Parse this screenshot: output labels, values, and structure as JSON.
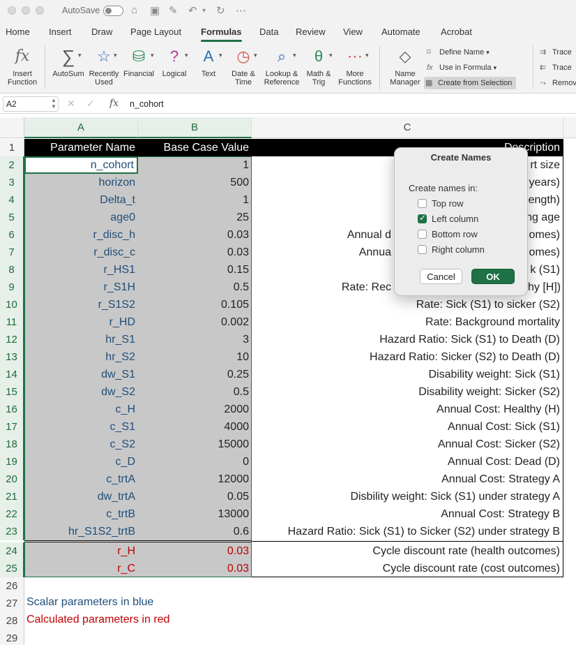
{
  "titlebar": {
    "autosave_label": "AutoSave",
    "autosave_state": "off"
  },
  "tabs": [
    "Home",
    "Insert",
    "Draw",
    "Page Layout",
    "Formulas",
    "Data",
    "Review",
    "View",
    "Automate",
    "Acrobat"
  ],
  "active_tab": "Formulas",
  "ribbon": {
    "insert_function": [
      "Insert",
      "Function"
    ],
    "autosum": "AutoSum",
    "recently_used": [
      "Recently",
      "Used"
    ],
    "financial": "Financial",
    "logical": "Logical",
    "text": "Text",
    "date_time": [
      "Date &",
      "Time"
    ],
    "lookup_reference": [
      "Lookup &",
      "Reference"
    ],
    "math_trig": [
      "Math &",
      "Trig"
    ],
    "more_functions": [
      "More",
      "Functions"
    ],
    "name_manager": [
      "Name",
      "Manager"
    ],
    "define_name": "Define Name",
    "use_in_formula": "Use in Formula",
    "create_from_selection": "Create from Selection",
    "trace_precedents": "Trace",
    "trace_dependents": "Trace",
    "remove_arrows": "Remov"
  },
  "formula_bar": {
    "name_box": "A2",
    "value": "n_cohort"
  },
  "columns": [
    "A",
    "B",
    "C"
  ],
  "header_row": {
    "a": "Parameter Name",
    "b": "Base Case Value",
    "c": "Description"
  },
  "rows": [
    {
      "n": "2",
      "a": "n_cohort",
      "b": "1",
      "c": "rt size",
      "calc": false
    },
    {
      "n": "3",
      "a": "horizon",
      "b": "500",
      "c": "years)",
      "calc": false
    },
    {
      "n": "4",
      "a": "Delta_t",
      "b": "1",
      "c": "ength)",
      "calc": false
    },
    {
      "n": "5",
      "a": "age0",
      "b": "25",
      "c": "ng age",
      "calc": false
    },
    {
      "n": "6",
      "a": "r_disc_h",
      "b": "0.03",
      "c": "Annual d",
      "c2": "omes)",
      "calc": false
    },
    {
      "n": "7",
      "a": "r_disc_c",
      "b": "0.03",
      "c": "Annua",
      "c2": "omes)",
      "calc": false
    },
    {
      "n": "8",
      "a": "r_HS1",
      "b": "0.15",
      "c": "k (S1)",
      "calc": false
    },
    {
      "n": "9",
      "a": "r_S1H",
      "b": "0.5",
      "c": "Rate: Rec",
      "c2": "hy [H])",
      "calc": false
    },
    {
      "n": "10",
      "a": "r_S1S2",
      "b": "0.105",
      "c": "Rate: Sick (S1) to sicker (S2)",
      "calc": false
    },
    {
      "n": "11",
      "a": "r_HD",
      "b": "0.002",
      "c": "Rate: Background mortality",
      "calc": false
    },
    {
      "n": "12",
      "a": "hr_S1",
      "b": "3",
      "c": "Hazard Ratio: Sick (S1) to Death (D)",
      "calc": false
    },
    {
      "n": "13",
      "a": "hr_S2",
      "b": "10",
      "c": "Hazard Ratio: Sicker (S2) to Death (D)",
      "calc": false
    },
    {
      "n": "14",
      "a": "dw_S1",
      "b": "0.25",
      "c": "Disability weight: Sick (S1)",
      "calc": false
    },
    {
      "n": "15",
      "a": "dw_S2",
      "b": "0.5",
      "c": "Disability weight: Sicker (S2)",
      "calc": false
    },
    {
      "n": "16",
      "a": "c_H",
      "b": "2000",
      "c": "Annual Cost: Healthy (H)",
      "calc": false
    },
    {
      "n": "17",
      "a": "c_S1",
      "b": "4000",
      "c": "Annual Cost: Sick (S1)",
      "calc": false
    },
    {
      "n": "18",
      "a": "c_S2",
      "b": "15000",
      "c": "Annual Cost: Sicker (S2)",
      "calc": false
    },
    {
      "n": "19",
      "a": "c_D",
      "b": "0",
      "c": "Annual Cost: Dead (D)",
      "calc": false
    },
    {
      "n": "20",
      "a": "c_trtA",
      "b": "12000",
      "c": "Annual Cost: Strategy A",
      "calc": false
    },
    {
      "n": "21",
      "a": "dw_trtA",
      "b": "0.05",
      "c": "Disbility weight: Sick (S1) under strategy A",
      "calc": false
    },
    {
      "n": "22",
      "a": "c_trtB",
      "b": "13000",
      "c": "Annual Cost: Strategy B",
      "calc": false
    },
    {
      "n": "23",
      "a": "hr_S1S2_trtB",
      "b": "0.6",
      "c": "Hazard Ratio: Sick (S1) to Sicker (S2) under strategy B",
      "calc": false
    },
    {
      "n": "24",
      "a": "r_H",
      "b": "0.03",
      "c": "Cycle discount rate (health outcomes)",
      "calc": true
    },
    {
      "n": "25",
      "a": "r_C",
      "b": "0.03",
      "c": "Cycle discount rate (cost outcomes)",
      "calc": true
    }
  ],
  "empty_rows": [
    "26",
    "27",
    "28",
    "29"
  ],
  "header_row_num": "1",
  "notes": {
    "blue": "Scalar parameters in blue",
    "red": "Calculated parameters in red"
  },
  "colors": {
    "accent": "#1e7145",
    "scalar": "#1f4e79",
    "calculated": "#c00000",
    "selection": "#c8c8c8"
  },
  "dialog": {
    "title": "Create Names",
    "subtitle": "Create names in:",
    "options": [
      {
        "label": "Top row",
        "checked": false
      },
      {
        "label": "Left column",
        "checked": true
      },
      {
        "label": "Bottom row",
        "checked": false
      },
      {
        "label": "Right column",
        "checked": false
      }
    ],
    "cancel": "Cancel",
    "ok": "OK"
  }
}
